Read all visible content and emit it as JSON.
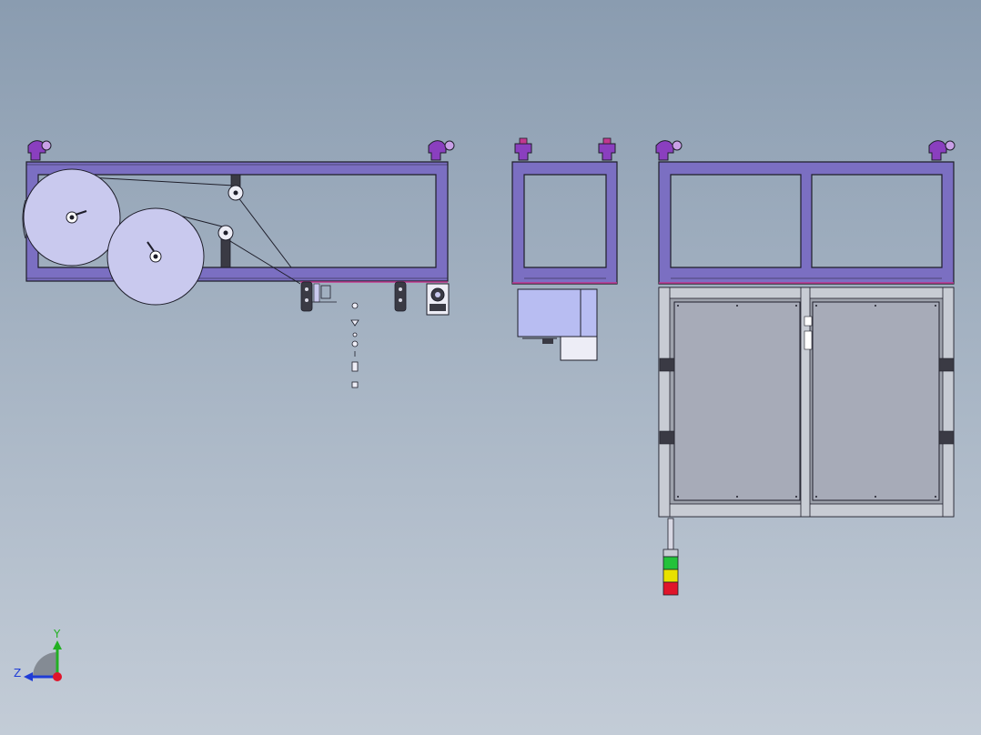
{
  "viewport": {
    "background_top": "#8a9cb0",
    "background_bottom": "#c3ccd7"
  },
  "colors": {
    "frame_purple": "#7b6fc2",
    "frame_outline": "#1e1e2a",
    "frame_pink_edge": "#c2388f",
    "wheel_fill": "#c9c9ee",
    "panel_gray": "#a7abb8",
    "motor_box": "#b8bdf2",
    "light_green": "#23c23a",
    "light_yellow": "#e8e100",
    "light_red": "#e0142a"
  },
  "views": [
    {
      "name": "side-view",
      "parts": [
        "machine-frame",
        "roller",
        "roller",
        "tensioner",
        "bracket",
        "bracket",
        "motor-bracket",
        "exploded-hardware"
      ]
    },
    {
      "name": "end-view",
      "parts": [
        "machine-frame",
        "motor-housing"
      ]
    },
    {
      "name": "front-view",
      "parts": [
        "machine-frame",
        "cabinet-door",
        "cabinet-door",
        "stack-light"
      ]
    }
  ],
  "stack_light": {
    "segments": [
      "green",
      "yellow",
      "red"
    ]
  },
  "triad": {
    "x_color": "#e0142a",
    "y_label": "Y",
    "y_color": "#22b022",
    "z_label": "Z",
    "z_color": "#1f3cd6"
  }
}
